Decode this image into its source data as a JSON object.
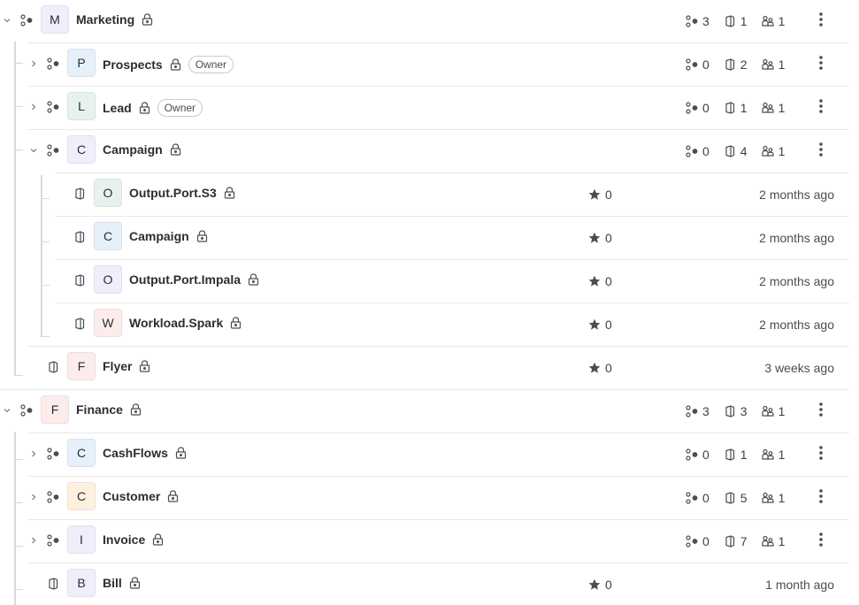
{
  "colors": {
    "avatar_purple": "#f1eefb",
    "avatar_blue": "#e6f0fa",
    "avatar_green": "#e8f2ec",
    "avatar_red": "#fcecec",
    "avatar_orange": "#fdf0de",
    "avatar_lavender": "#efeefb"
  },
  "rows": [
    {
      "name": "Marketing",
      "initial": "M",
      "kind": "domain",
      "expanded": true,
      "lock": true,
      "stats": {
        "subdomains": "3",
        "products": "1",
        "owners": "1"
      }
    },
    {
      "name": "Prospects",
      "initial": "P",
      "kind": "domain",
      "expanded": false,
      "lock": true,
      "badge": "Owner",
      "stats": {
        "subdomains": "0",
        "products": "2",
        "owners": "1"
      }
    },
    {
      "name": "Lead",
      "initial": "L",
      "kind": "domain",
      "expanded": false,
      "lock": true,
      "badge": "Owner",
      "stats": {
        "subdomains": "0",
        "products": "1",
        "owners": "1"
      }
    },
    {
      "name": "Campaign",
      "initial": "C",
      "kind": "domain",
      "expanded": true,
      "lock": true,
      "stats": {
        "subdomains": "0",
        "products": "4",
        "owners": "1"
      }
    },
    {
      "name": "Output.Port.S3",
      "initial": "O",
      "kind": "product",
      "lock": true,
      "stars": "0",
      "updated": "2 months ago"
    },
    {
      "name": "Campaign",
      "initial": "C",
      "kind": "product",
      "lock": true,
      "stars": "0",
      "updated": "2 months ago"
    },
    {
      "name": "Output.Port.Impala",
      "initial": "O",
      "kind": "product",
      "lock": true,
      "stars": "0",
      "updated": "2 months ago"
    },
    {
      "name": "Workload.Spark",
      "initial": "W",
      "kind": "product",
      "lock": true,
      "stars": "0",
      "updated": "2 months ago"
    },
    {
      "name": "Flyer",
      "initial": "F",
      "kind": "product",
      "lock": true,
      "stars": "0",
      "updated": "3 weeks ago"
    },
    {
      "name": "Finance",
      "initial": "F",
      "kind": "domain",
      "expanded": true,
      "lock": true,
      "stats": {
        "subdomains": "3",
        "products": "3",
        "owners": "1"
      }
    },
    {
      "name": "CashFlows",
      "initial": "C",
      "kind": "domain",
      "expanded": false,
      "lock": true,
      "stats": {
        "subdomains": "0",
        "products": "1",
        "owners": "1"
      }
    },
    {
      "name": "Customer",
      "initial": "C",
      "kind": "domain",
      "expanded": false,
      "lock": true,
      "stats": {
        "subdomains": "0",
        "products": "5",
        "owners": "1"
      }
    },
    {
      "name": "Invoice",
      "initial": "I",
      "kind": "domain",
      "expanded": false,
      "lock": true,
      "stats": {
        "subdomains": "0",
        "products": "7",
        "owners": "1"
      }
    },
    {
      "name": "Bill",
      "initial": "B",
      "kind": "product",
      "lock": true,
      "stars": "0",
      "updated": "1 month ago"
    }
  ]
}
